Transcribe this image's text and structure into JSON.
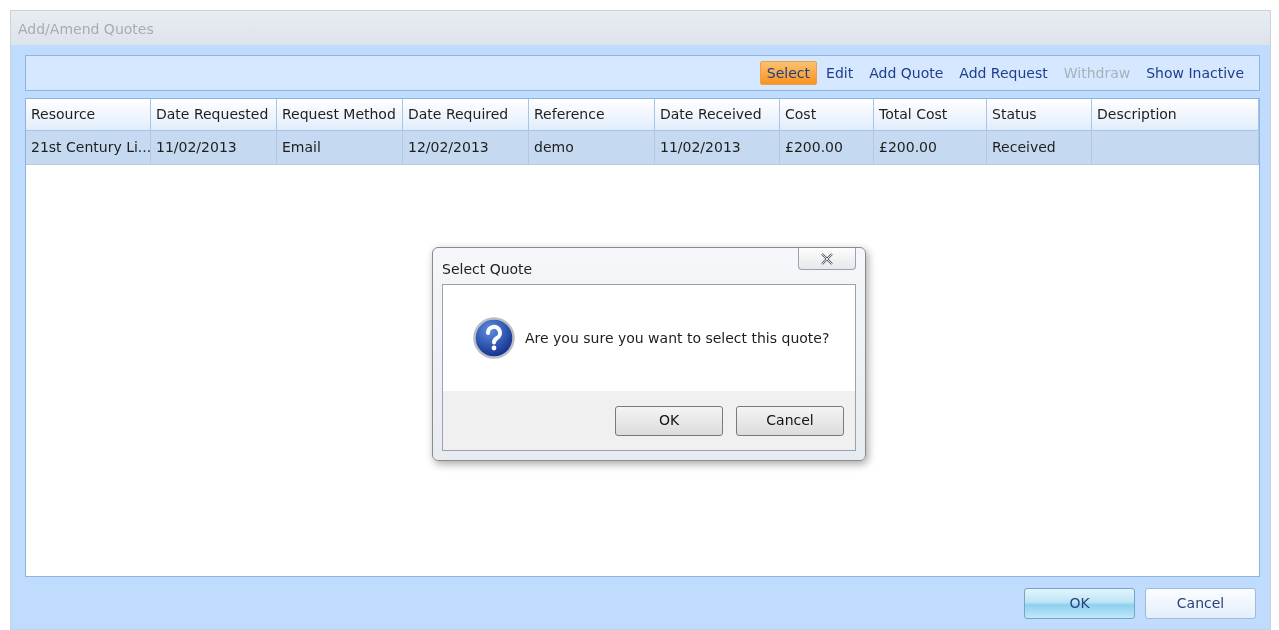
{
  "window": {
    "title": "Add/Amend Quotes"
  },
  "toolbar": [
    {
      "label": "Select",
      "selected": true,
      "disabled": false
    },
    {
      "label": "Edit",
      "selected": false,
      "disabled": false
    },
    {
      "label": "Add Quote",
      "selected": false,
      "disabled": false
    },
    {
      "label": "Add Request",
      "selected": false,
      "disabled": false
    },
    {
      "label": "Withdraw",
      "selected": false,
      "disabled": true
    },
    {
      "label": "Show Inactive",
      "selected": false,
      "disabled": false
    }
  ],
  "table": {
    "columns": [
      "Resource",
      "Date Requested",
      "Request Method",
      "Date Required",
      "Reference",
      "Date Received",
      "Cost",
      "Total Cost",
      "Status",
      "Description"
    ],
    "rows": [
      {
        "selected": true,
        "cells": [
          "21st Century Li...",
          "11/02/2013",
          "Email",
          "12/02/2013",
          "demo",
          "11/02/2013",
          "£200.00",
          "£200.00",
          "Received",
          ""
        ]
      }
    ]
  },
  "dialog": {
    "title": "Select Quote",
    "message": "Are you sure you want to select this quote?",
    "buttons": [
      {
        "label": "OK",
        "default": false
      },
      {
        "label": "Cancel",
        "default": false
      }
    ]
  },
  "buttons": [
    {
      "label": "OK",
      "default": true
    },
    {
      "label": "Cancel",
      "default": false
    }
  ]
}
